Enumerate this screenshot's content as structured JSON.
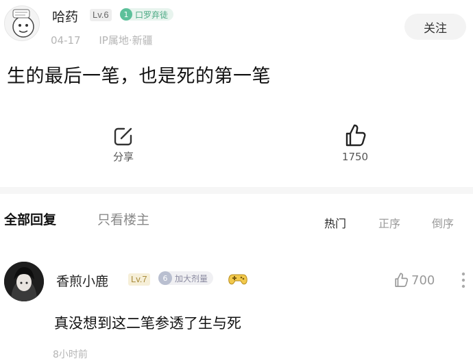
{
  "post": {
    "username": "哈药",
    "level": "Lv.6",
    "fan_badge": "口罗弃徒",
    "fan_badge_num": "1",
    "date": "04-17",
    "ip": "IP属地·新疆",
    "follow_label": "关注",
    "text": "生的最后一笔，也是死的第一笔",
    "share_label": "分享",
    "like_count": "1750"
  },
  "replies": {
    "tab_all": "全部回复",
    "tab_owner_only": "只看楼主",
    "sort_hot": "热门",
    "sort_asc": "正序",
    "sort_desc": "倒序"
  },
  "comment": {
    "username": "香煎小鹿",
    "level": "Lv.7",
    "badge": "加大剂量",
    "badge_num": "6",
    "like_count": "700",
    "text": "真没想到这二笔参透了生与死",
    "time": "8小时前"
  },
  "colors": {
    "accent_green": "#5cc09a",
    "muted_gray": "#b5b5b5"
  }
}
